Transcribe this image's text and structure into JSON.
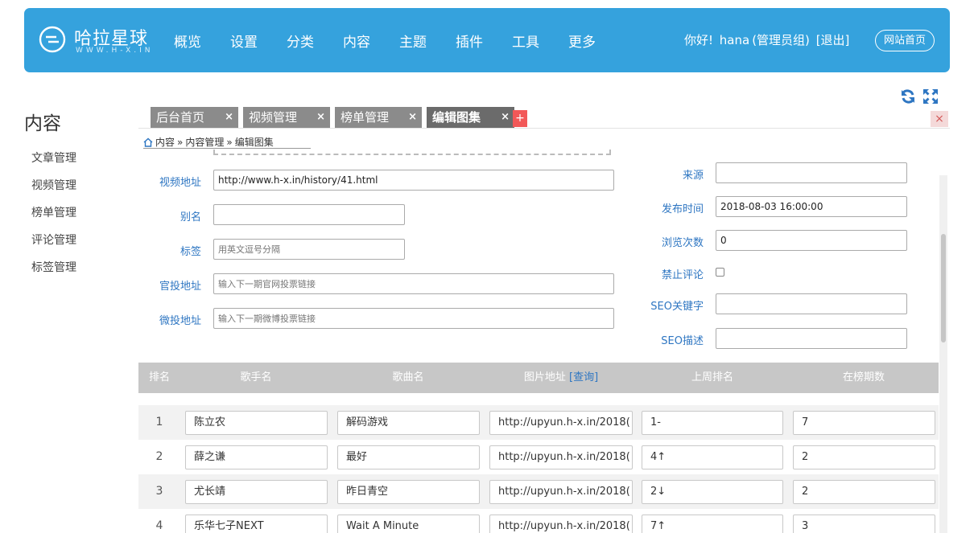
{
  "brand": {
    "name": "哈拉星球",
    "sub": "WWW.H-X.IN"
  },
  "nav": [
    "概览",
    "设置",
    "分类",
    "内容",
    "主题",
    "插件",
    "工具",
    "更多"
  ],
  "user": {
    "greeting": "你好!",
    "name": "hana",
    "role": "(管理员组)",
    "logout": "[退出]",
    "site_button": "网站首页"
  },
  "sidebar": {
    "title": "内容",
    "items": [
      "文章管理",
      "视频管理",
      "榜单管理",
      "评论管理",
      "标签管理"
    ]
  },
  "tabs": [
    {
      "label": "后台首页",
      "close": "×"
    },
    {
      "label": "视频管理",
      "close": "×"
    },
    {
      "label": "榜单管理",
      "close": "×"
    },
    {
      "label": "编辑图集",
      "close": "×"
    }
  ],
  "tab_add": "+",
  "tab_close_all": "×",
  "breadcrumb": [
    "内容",
    "»",
    "内容管理",
    "»",
    "编辑图集"
  ],
  "form_left": {
    "video_url": {
      "label": "视频地址",
      "value": "http://www.h-x.in/history/41.html"
    },
    "alias": {
      "label": "别名",
      "value": ""
    },
    "tags": {
      "label": "标签",
      "placeholder": "用英文逗号分隔"
    },
    "official_vote": {
      "label": "官投地址",
      "placeholder": "输入下一期官网投票链接"
    },
    "weibo_vote": {
      "label": "微投地址",
      "placeholder": "输入下一期微博投票链接"
    }
  },
  "form_right": {
    "source": {
      "label": "来源",
      "value": ""
    },
    "publish_time": {
      "label": "发布时间",
      "value": "2018-08-03 16:00:00"
    },
    "views": {
      "label": "浏览次数",
      "value": "0"
    },
    "no_comment": {
      "label": "禁止评论",
      "checked": false
    },
    "seo_keywords": {
      "label": "SEO关键字",
      "value": ""
    },
    "seo_desc": {
      "label": "SEO描述",
      "value": ""
    }
  },
  "table": {
    "headers": [
      "排名",
      "歌手名",
      "歌曲名",
      "图片地址",
      "上周排名",
      "在榜期数"
    ],
    "query_link": "[查询]",
    "rows": [
      {
        "rank": "1",
        "singer": "陈立农",
        "song": "解码游戏",
        "image": "http://upyun.h-x.in/2018(",
        "last_week": "1-",
        "weeks": "7"
      },
      {
        "rank": "2",
        "singer": "薛之谦",
        "song": "最好",
        "image": "http://upyun.h-x.in/2018(",
        "last_week": "4↑",
        "weeks": "2"
      },
      {
        "rank": "3",
        "singer": "尤长靖",
        "song": "昨日青空",
        "image": "http://upyun.h-x.in/2018(",
        "last_week": "2↓",
        "weeks": "2"
      },
      {
        "rank": "4",
        "singer": "乐华七子NEXT",
        "song": "Wait A Minute",
        "image": "http://upyun.h-x.in/2018(",
        "last_week": "7↑",
        "weeks": "3"
      }
    ]
  },
  "colors": {
    "primary": "#35a2dd",
    "label_blue": "#2e76c2",
    "tab_gray": "#8b8b8b",
    "danger": "#f25858"
  },
  "icons": [
    "refresh-icon",
    "fullscreen-icon",
    "home-icon"
  ]
}
